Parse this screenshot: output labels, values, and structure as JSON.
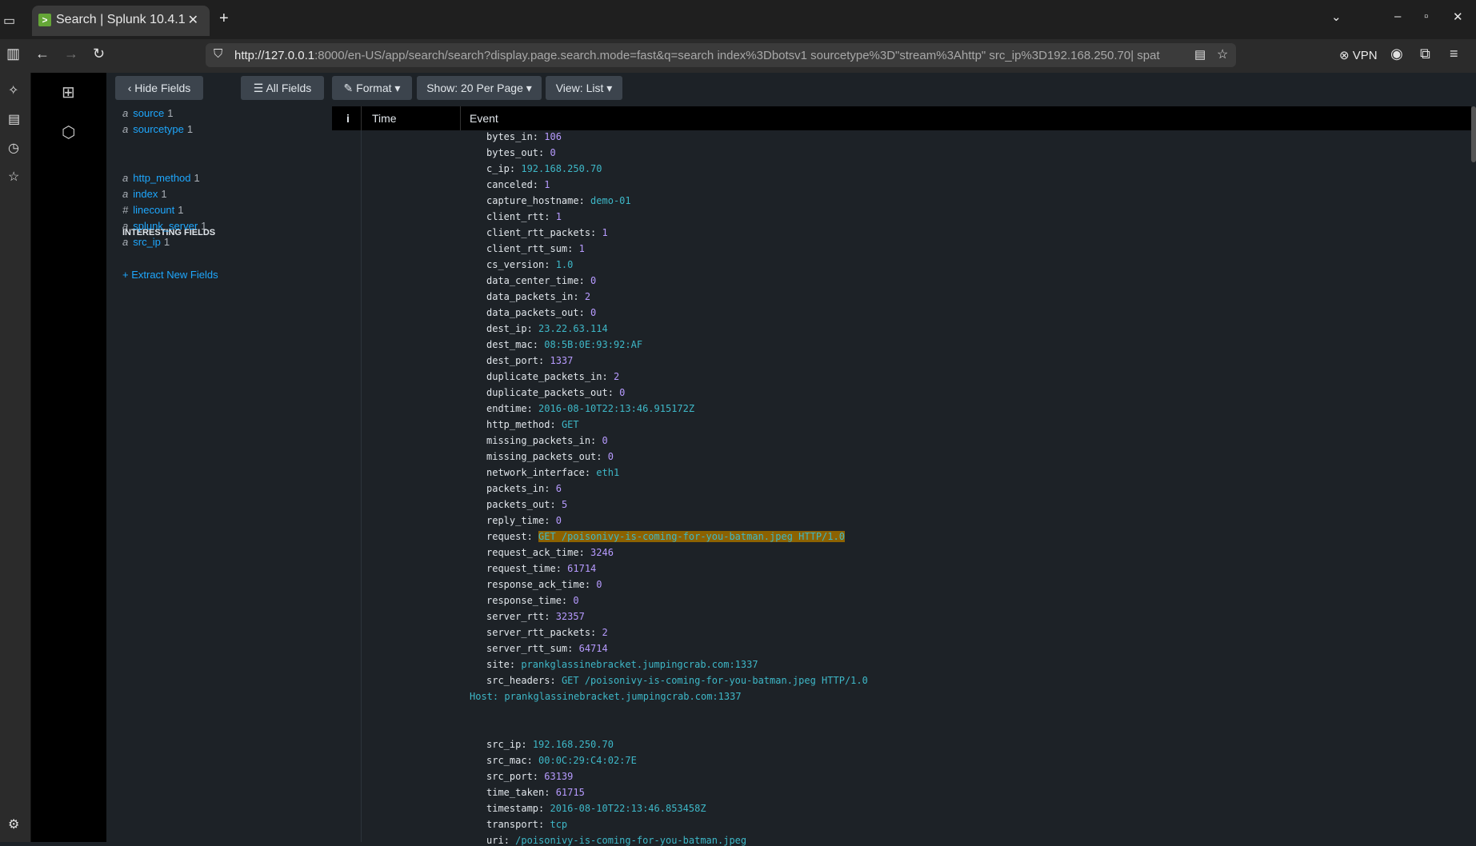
{
  "browser": {
    "tab_title": "Search | Splunk 10.4.1",
    "tab_favicon": ">",
    "url_host": "http://127.0.0.1",
    "url_rest": ":8000/en-US/app/search/search?display.page.search.mode=fast&q=search index%3Dbotsv1 sourcetype%3D\"stream%3Ahttp\" src_ip%3D192.168.250.70| spat",
    "vpn_label": "VPN"
  },
  "toolbar": {
    "hide_fields": "‹ Hide Fields",
    "all_fields": "All Fields",
    "format": "Format",
    "show": "Show: 20 Per Page",
    "view": "View: List"
  },
  "fields": {
    "selected": [
      {
        "type": "a",
        "name": "source",
        "count": "1"
      },
      {
        "type": "a",
        "name": "sourcetype",
        "count": "1"
      }
    ],
    "interesting_header": "INTERESTING FIELDS",
    "interesting": [
      {
        "type": "a",
        "name": "http_method",
        "count": "1"
      },
      {
        "type": "a",
        "name": "index",
        "count": "1"
      },
      {
        "type": "#",
        "name": "linecount",
        "count": "1"
      },
      {
        "type": "a",
        "name": "splunk_server",
        "count": "1"
      },
      {
        "type": "a",
        "name": "src_ip",
        "count": "1"
      }
    ],
    "extract_label": "+ Extract New Fields"
  },
  "columns": {
    "info": "i",
    "time": "Time",
    "event": "Event"
  },
  "event_lines": [
    {
      "k": "bytes_in",
      "v": "106",
      "t": "n"
    },
    {
      "k": "bytes_out",
      "v": "0",
      "t": "n"
    },
    {
      "k": "c_ip",
      "v": "192.168.250.70",
      "t": "s"
    },
    {
      "k": "canceled",
      "v": "1",
      "t": "n"
    },
    {
      "k": "capture_hostname",
      "v": "demo-01",
      "t": "s"
    },
    {
      "k": "client_rtt",
      "v": "1",
      "t": "n"
    },
    {
      "k": "client_rtt_packets",
      "v": "1",
      "t": "n"
    },
    {
      "k": "client_rtt_sum",
      "v": "1",
      "t": "n"
    },
    {
      "k": "cs_version",
      "v": "1.0",
      "t": "s"
    },
    {
      "k": "data_center_time",
      "v": "0",
      "t": "n"
    },
    {
      "k": "data_packets_in",
      "v": "2",
      "t": "n"
    },
    {
      "k": "data_packets_out",
      "v": "0",
      "t": "n"
    },
    {
      "k": "dest_ip",
      "v": "23.22.63.114",
      "t": "s"
    },
    {
      "k": "dest_mac",
      "v": "08:5B:0E:93:92:AF",
      "t": "s"
    },
    {
      "k": "dest_port",
      "v": "1337",
      "t": "n"
    },
    {
      "k": "duplicate_packets_in",
      "v": "2",
      "t": "n"
    },
    {
      "k": "duplicate_packets_out",
      "v": "0",
      "t": "n"
    },
    {
      "k": "endtime",
      "v": "2016-08-10T22:13:46.915172Z",
      "t": "s"
    },
    {
      "k": "http_method",
      "v": "GET",
      "t": "s"
    },
    {
      "k": "missing_packets_in",
      "v": "0",
      "t": "n"
    },
    {
      "k": "missing_packets_out",
      "v": "0",
      "t": "n"
    },
    {
      "k": "network_interface",
      "v": "eth1",
      "t": "s"
    },
    {
      "k": "packets_in",
      "v": "6",
      "t": "n"
    },
    {
      "k": "packets_out",
      "v": "5",
      "t": "n"
    },
    {
      "k": "reply_time",
      "v": "0",
      "t": "n"
    },
    {
      "k": "request",
      "v": "GET /poisonivy-is-coming-for-you-batman.jpeg HTTP/1.0",
      "t": "h"
    },
    {
      "k": "request_ack_time",
      "v": "3246",
      "t": "n"
    },
    {
      "k": "request_time",
      "v": "61714",
      "t": "n"
    },
    {
      "k": "response_ack_time",
      "v": "0",
      "t": "n"
    },
    {
      "k": "response_time",
      "v": "0",
      "t": "n"
    },
    {
      "k": "server_rtt",
      "v": "32357",
      "t": "n"
    },
    {
      "k": "server_rtt_packets",
      "v": "2",
      "t": "n"
    },
    {
      "k": "server_rtt_sum",
      "v": "64714",
      "t": "n"
    },
    {
      "k": "site",
      "v": "prankglassinebracket.jumpingcrab.com:1337",
      "t": "s"
    },
    {
      "k": "src_headers",
      "v": "GET /poisonivy-is-coming-for-you-batman.jpeg HTTP/1.0",
      "t": "s"
    }
  ],
  "host_line": "Host: prankglassinebracket.jumpingcrab.com:1337",
  "event_lines_2": [
    {
      "k": "src_ip",
      "v": "192.168.250.70",
      "t": "s"
    },
    {
      "k": "src_mac",
      "v": "00:0C:29:C4:02:7E",
      "t": "s"
    },
    {
      "k": "src_port",
      "v": "63139",
      "t": "n"
    },
    {
      "k": "time_taken",
      "v": "61715",
      "t": "n"
    },
    {
      "k": "timestamp",
      "v": "2016-08-10T22:13:46.853458Z",
      "t": "s"
    },
    {
      "k": "transport",
      "v": "tcp",
      "t": "s"
    },
    {
      "k": "uri",
      "v": "/poisonivy-is-coming-for-you-batman.jpeg",
      "t": "s"
    }
  ]
}
